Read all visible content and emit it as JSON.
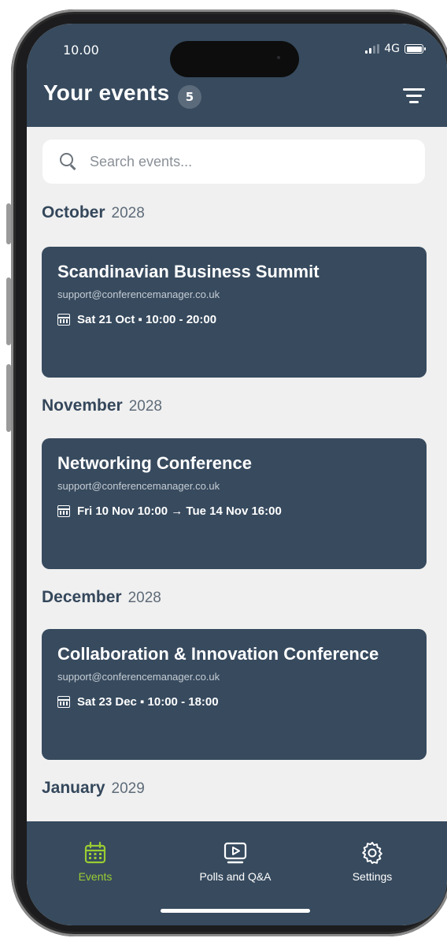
{
  "status_bar": {
    "time": "10.00",
    "network": "4G"
  },
  "header": {
    "title": "Your events",
    "count": "5"
  },
  "search": {
    "placeholder": "Search events..."
  },
  "sections": [
    {
      "month": "October",
      "year": "2028",
      "event": {
        "title": "Scandinavian Business Summit",
        "email": "support@conferencemanager.co.uk",
        "date": "Sat 21 Oct ▪ 10:00 - 20:00"
      }
    },
    {
      "month": "November",
      "year": "2028",
      "event": {
        "title": "Networking Conference",
        "email": "support@conferencemanager.co.uk",
        "date": "Fri 10 Nov 10:00 → Tue 14 Nov 16:00"
      }
    },
    {
      "month": "December",
      "year": "2028",
      "event": {
        "title": "Collaboration & Innovation Conference",
        "email": "support@conferencemanager.co.uk",
        "date": "Sat 23 Dec ▪ 10:00 - 18:00"
      }
    },
    {
      "month": "January",
      "year": "2029"
    }
  ],
  "tabs": [
    {
      "label": "Events",
      "icon": "calendar-icon",
      "active": true
    },
    {
      "label": "Polls and Q&A",
      "icon": "play-screen-icon",
      "active": false
    },
    {
      "label": "Settings",
      "icon": "gear-icon",
      "active": false
    }
  ],
  "colors": {
    "header": "#374a5e",
    "card": "#374a5e",
    "background": "#f0f0f0",
    "accent_active": "#9acd32"
  }
}
